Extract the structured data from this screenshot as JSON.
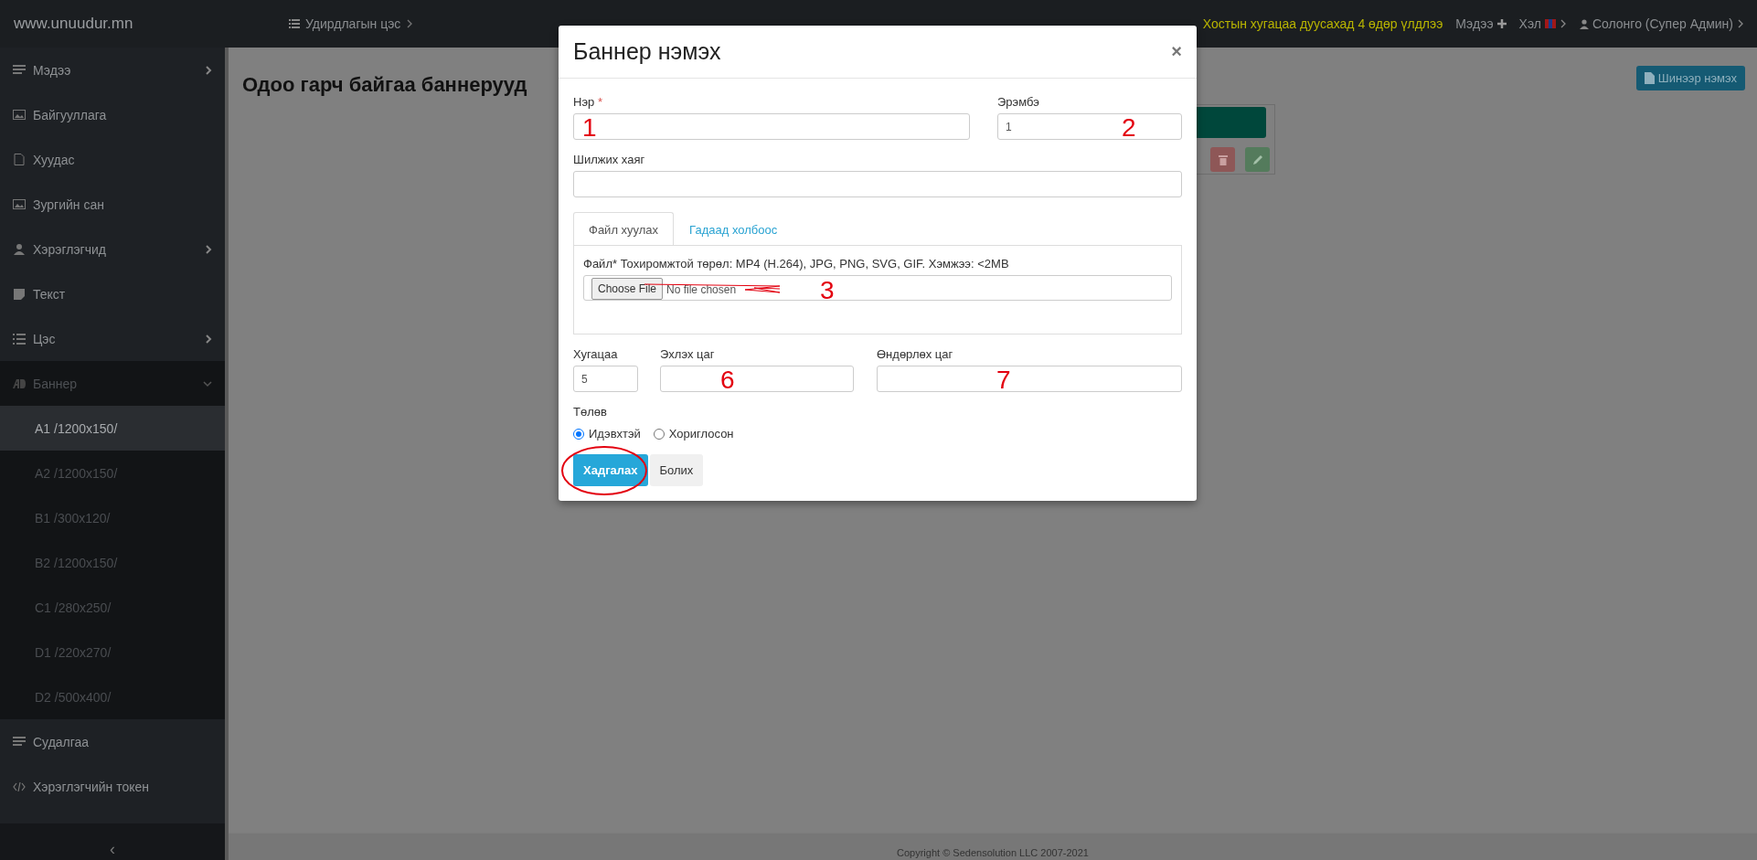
{
  "topbar": {
    "brand": "www.unuudur.mn",
    "menu": "Удирдлагын цэс",
    "notice": "Хостын хугацаа дуусахад 4 өдөр үлдлээ",
    "news": "Мэдээ",
    "language": "Хэл",
    "user": "Солонго (Супер Админ)"
  },
  "sidebar": {
    "items": [
      {
        "label": "Мэдээ",
        "expandable": true,
        "expanded": false
      },
      {
        "label": "Байгууллага",
        "expandable": false,
        "expanded": false
      },
      {
        "label": "Хуудас",
        "expandable": false,
        "expanded": false
      },
      {
        "label": "Зургийн сан",
        "expandable": false,
        "expanded": false
      },
      {
        "label": "Хэрэглэгчид",
        "expandable": true,
        "expanded": false
      },
      {
        "label": "Текст",
        "expandable": false,
        "expanded": false
      },
      {
        "label": "Цэс",
        "expandable": true,
        "expanded": false
      },
      {
        "label": "Баннер",
        "expandable": true,
        "expanded": true,
        "children": [
          {
            "label": "A1 /1200x150/",
            "selected": true
          },
          {
            "label": "A2 /1200x150/",
            "selected": false
          },
          {
            "label": "B1 /300x120/",
            "selected": false
          },
          {
            "label": "B2 /1200x150/",
            "selected": false
          },
          {
            "label": "C1 /280x250/",
            "selected": false
          },
          {
            "label": "D1 /220x270/",
            "selected": false
          },
          {
            "label": "D2 /500x400/",
            "selected": false
          }
        ]
      },
      {
        "label": "Судалгаа",
        "expandable": false,
        "expanded": false
      },
      {
        "label": "Хэрэглэгчийн токен",
        "expandable": false,
        "expanded": false
      }
    ],
    "collapse": "‹"
  },
  "page": {
    "title": "Одоо гарч байгаа баннерууд",
    "add_button": "Шинээр нэмэх"
  },
  "dialog": {
    "title": "Баннер нэмэх",
    "close": "×",
    "name": {
      "label": "Нэр",
      "required_mark": "*",
      "annotation": "1"
    },
    "order": {
      "label": "Эрэмбэ",
      "value": "1",
      "annotation": "2"
    },
    "link": {
      "label": "Шилжих хаяг"
    },
    "tabs": [
      {
        "label": "Файл хуулах",
        "selected": true
      },
      {
        "label": "Гадаад холбоос",
        "selected": false
      }
    ],
    "file": {
      "hint": "Файл* Тохиромжтой төрөл: MP4 (H.264), JPG, PNG, SVG, GIF. Хэмжээ: <2MB",
      "button": "Choose File",
      "status": "No file chosen",
      "annotation": "3"
    },
    "duration": {
      "label": "Хугацаа",
      "value": "5"
    },
    "start": {
      "label": "Эхлэх цаг",
      "annotation": "6"
    },
    "end": {
      "label": "Өндөрлөх цаг",
      "annotation": "7"
    },
    "status": {
      "label": "Төлөв",
      "options": [
        {
          "label": "Идэвхтэй",
          "selected": true
        },
        {
          "label": "Хориглосон",
          "selected": false
        }
      ]
    },
    "buttons": [
      {
        "label": "Хадгалах",
        "kind": "primary",
        "circled": true
      },
      {
        "label": "Болих",
        "kind": "default",
        "circled": false
      }
    ]
  },
  "footer": {
    "text": "Copyright © Sedensolution LLC 2007-2021"
  }
}
